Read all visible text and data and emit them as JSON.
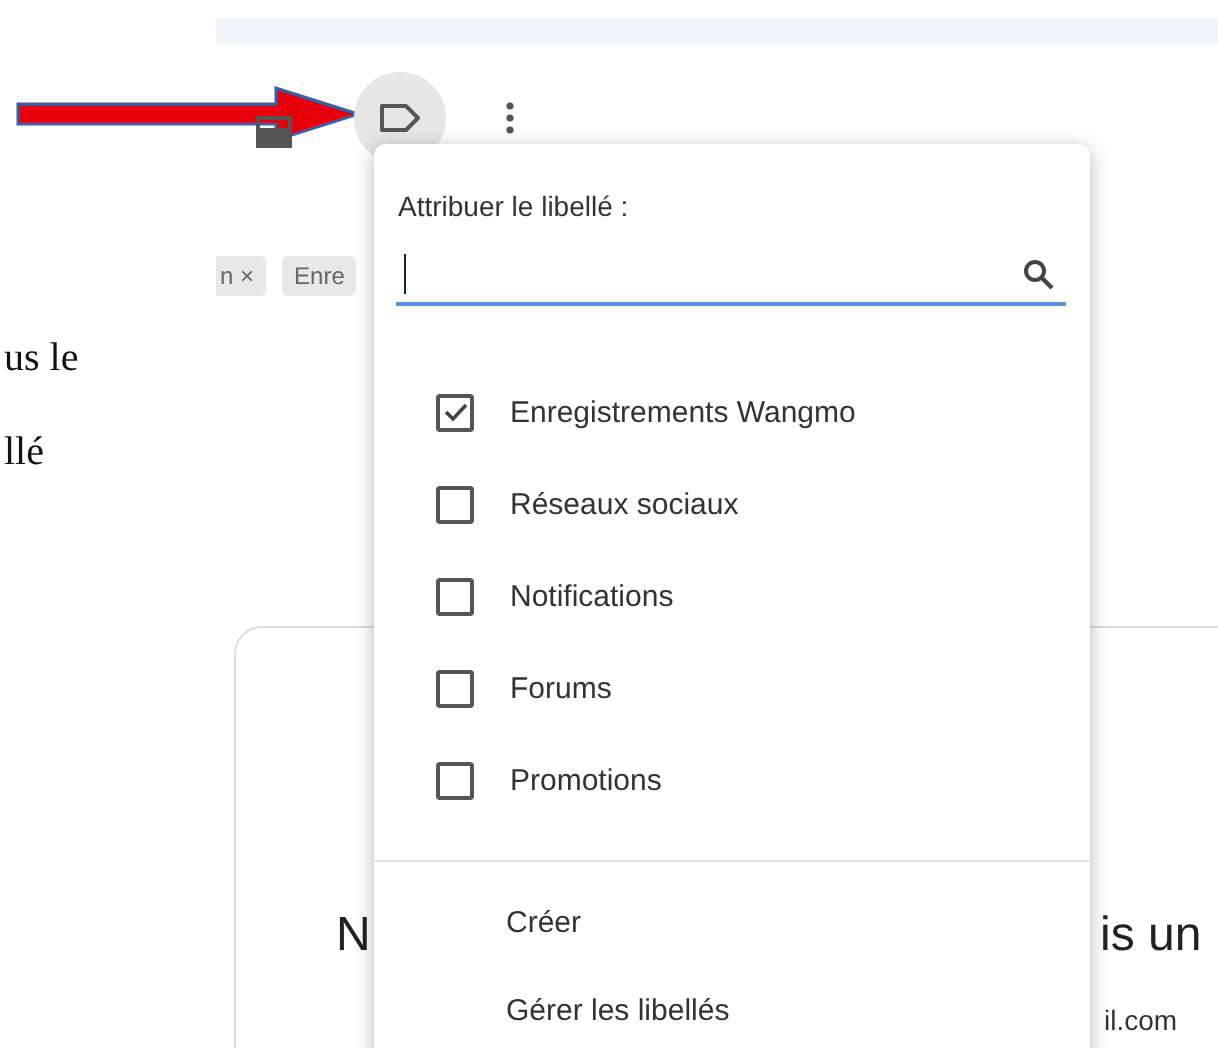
{
  "background_text": [
    "us le",
    "llé"
  ],
  "chips": [
    "n ×",
    "Enre"
  ],
  "card": {
    "title_left": "N",
    "title_right": "is un",
    "subtitle": "il.com"
  },
  "label_menu": {
    "title": "Attribuer le libellé :",
    "labels": [
      {
        "name": "Enregistrements Wangmo",
        "checked": true
      },
      {
        "name": "Réseaux sociaux",
        "checked": false
      },
      {
        "name": "Notifications",
        "checked": false
      },
      {
        "name": "Forums",
        "checked": false
      },
      {
        "name": "Promotions",
        "checked": false
      }
    ],
    "actions": [
      "Créer",
      "Gérer les libellés"
    ]
  }
}
